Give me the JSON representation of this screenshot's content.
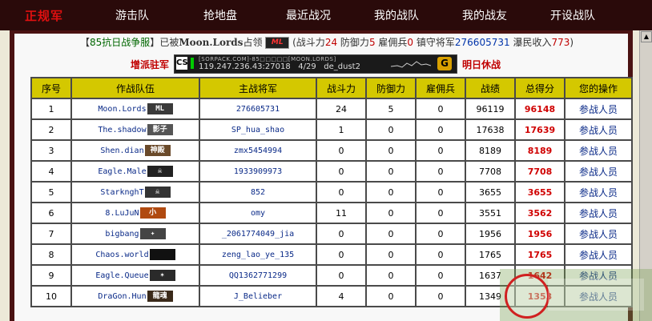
{
  "nav": {
    "logo": "正规军",
    "items": [
      "游击队",
      "抢地盘",
      "最近战况",
      "我的战队",
      "我的战友",
      "开设战队"
    ]
  },
  "announce": {
    "server": "85抗日战争服",
    "pre": "已被",
    "team": "Moon.Lords",
    "post": "占领",
    "team_emblem": "ML",
    "stats_open": "(",
    "power_label": "战斗力",
    "power": "24",
    "defense_label": "防御力",
    "defense": "5",
    "merc_label": "雇佣兵",
    "merc": "0",
    "general_label": "镇守将军",
    "general": "276605731",
    "income_label": "瀑民收入",
    "income": "773",
    "stats_close": ")"
  },
  "status": {
    "left_btn": "增派驻军",
    "right_btn": "明日休战",
    "server_line1": "[SORPACK.COM]-85□□□□□[MOON.LORDS]",
    "server_ip": "119.247.236.43:27018",
    "players": "4/29",
    "map": "de_dust2",
    "game_icon": "CS",
    "refresh_icon": "G"
  },
  "table": {
    "headers": [
      "序号",
      "作战队伍",
      "主战将军",
      "战斗力",
      "防御力",
      "雇佣兵",
      "战绩",
      "总得分",
      "您的操作"
    ],
    "rows": [
      {
        "no": "1",
        "team": "Moon.Lords",
        "emblem": "ML",
        "emblem_color": "#3a3a3a",
        "general": "276605731",
        "power": "24",
        "defense": "5",
        "merc": "0",
        "record": "96119",
        "score": "96148",
        "action": "参战人员"
      },
      {
        "no": "2",
        "team": "The.shadow",
        "emblem": "影子",
        "emblem_color": "#555555",
        "general": "SP_hua_shao",
        "power": "1",
        "defense": "0",
        "merc": "0",
        "record": "17638",
        "score": "17639",
        "action": "参战人员"
      },
      {
        "no": "3",
        "team": "Shen.dian",
        "emblem": "神殿",
        "emblem_color": "#6a4a2a",
        "general": "zmx5454994",
        "power": "0",
        "defense": "0",
        "merc": "0",
        "record": "8189",
        "score": "8189",
        "action": "参战人员"
      },
      {
        "no": "4",
        "team": "Eagle.Male",
        "emblem": "☠",
        "emblem_color": "#222222",
        "general": "1933909973",
        "power": "0",
        "defense": "0",
        "merc": "0",
        "record": "7708",
        "score": "7708",
        "action": "参战人员"
      },
      {
        "no": "5",
        "team": "StarknghT",
        "emblem": "☠",
        "emblem_color": "#333333",
        "general": "852",
        "power": "0",
        "defense": "0",
        "merc": "0",
        "record": "3655",
        "score": "3655",
        "action": "参战人员"
      },
      {
        "no": "6",
        "team": "8.LuJuN",
        "emblem": "小",
        "emblem_color": "#b04a10",
        "general": "omy",
        "power": "11",
        "defense": "0",
        "merc": "0",
        "record": "3551",
        "score": "3562",
        "action": "参战人员"
      },
      {
        "no": "7",
        "team": "bigbang",
        "emblem": "✦",
        "emblem_color": "#444444",
        "general": "_2061774049_jia",
        "power": "0",
        "defense": "0",
        "merc": "0",
        "record": "1956",
        "score": "1956",
        "action": "参战人员"
      },
      {
        "no": "8",
        "team": "Chaos.world",
        "emblem": "",
        "emblem_color": "#111111",
        "general": "zeng_lao_ye_135",
        "power": "0",
        "defense": "0",
        "merc": "0",
        "record": "1765",
        "score": "1765",
        "action": "参战人员"
      },
      {
        "no": "9",
        "team": "Eagle.Queue",
        "emblem": "✶",
        "emblem_color": "#2a2a2a",
        "general": "QQ1362771299",
        "power": "0",
        "defense": "0",
        "merc": "0",
        "record": "1637",
        "score": "1642",
        "action": "参战人员"
      },
      {
        "no": "10",
        "team": "DraGon.Hun",
        "emblem": "龍魂",
        "emblem_color": "#3a2a1a",
        "general": "J_Belieber",
        "power": "4",
        "defense": "0",
        "merc": "0",
        "record": "1349",
        "score": "1353",
        "action": "参战人员"
      }
    ]
  }
}
